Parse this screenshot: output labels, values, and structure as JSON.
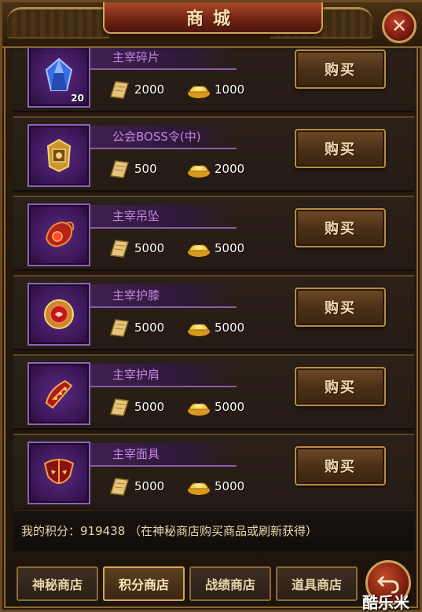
{
  "window": {
    "title": "商城"
  },
  "currencies": {
    "scroll_icon": "scroll-icon",
    "gold_icon": "gold-ingot-icon"
  },
  "items": [
    {
      "name": "主宰碎片",
      "icon": "gem-icon",
      "qty": "20",
      "points": "2000",
      "gold": "1000",
      "buy_label": "购买"
    },
    {
      "name": "公会BOSS令(中)",
      "icon": "badge-icon",
      "qty": "",
      "points": "500",
      "gold": "2000",
      "buy_label": "购买"
    },
    {
      "name": "主宰吊坠",
      "icon": "pendant-icon",
      "qty": "",
      "points": "5000",
      "gold": "5000",
      "buy_label": "购买"
    },
    {
      "name": "主宰护膝",
      "icon": "kneeguard-icon",
      "qty": "",
      "points": "5000",
      "gold": "5000",
      "buy_label": "购买"
    },
    {
      "name": "主宰护肩",
      "icon": "shoulderguard-icon",
      "qty": "",
      "points": "5000",
      "gold": "5000",
      "buy_label": "购买"
    },
    {
      "name": "主宰面具",
      "icon": "mask-icon",
      "qty": "",
      "points": "5000",
      "gold": "5000",
      "buy_label": "购买"
    }
  ],
  "points": {
    "text": "我的积分：919438 （在神秘商店购买商品或刷新获得）"
  },
  "tabs": [
    {
      "label": "神秘商店",
      "active": false
    },
    {
      "label": "积分商店",
      "active": true
    },
    {
      "label": "战绩商店",
      "active": false
    },
    {
      "label": "道具商店",
      "active": false
    }
  ],
  "watermark": {
    "text": "酷乐米"
  }
}
